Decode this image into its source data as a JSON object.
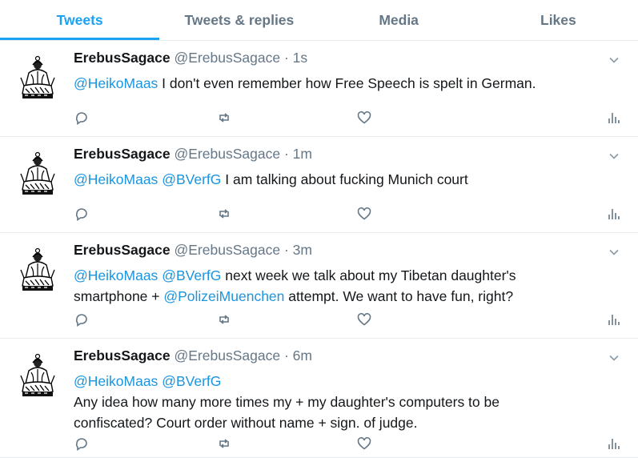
{
  "tabs": [
    "Tweets",
    "Tweets & replies",
    "Media",
    "Likes"
  ],
  "tweets": [
    {
      "name": "ErebusSagace",
      "handle": "@ErebusSagace",
      "dot": "·",
      "time": "1s",
      "lines": [
        [
          {
            "m": "@HeikoMaas"
          },
          {
            "t": " I don't even remember how Free Speech is spelt in German."
          }
        ]
      ]
    },
    {
      "name": "ErebusSagace",
      "handle": "@ErebusSagace",
      "dot": "·",
      "time": "1m",
      "lines": [
        [
          {
            "m": "@HeikoMaas"
          },
          {
            "t": " "
          },
          {
            "m": "@BVerfG"
          },
          {
            "t": " I am talking about fucking Munich court"
          }
        ]
      ]
    },
    {
      "name": "ErebusSagace",
      "handle": "@ErebusSagace",
      "dot": "·",
      "time": "3m",
      "lines": [
        [
          {
            "m": "@HeikoMaas"
          },
          {
            "t": " "
          },
          {
            "m": "@BVerfG"
          },
          {
            "t": " next week we talk about my Tibetan daughter's"
          }
        ],
        [
          {
            "t": "smartphone + "
          },
          {
            "m": "@PolizeiMuenchen"
          },
          {
            "t": " attempt. We want to have fun, right?"
          }
        ]
      ]
    },
    {
      "name": "ErebusSagace",
      "handle": "@ErebusSagace",
      "dot": "·",
      "time": "6m",
      "lines": [
        [
          {
            "m": "@HeikoMaas"
          },
          {
            "t": " "
          },
          {
            "m": "@BVerfG"
          }
        ],
        [
          {
            "t": "Any idea how many more times my + my daughter's computers to be"
          }
        ],
        [
          {
            "t": "confiscated? Court order without name + sign. of judge."
          }
        ]
      ]
    }
  ],
  "colors": {
    "accent": "#1da1f2",
    "mention": "#1b95e0",
    "muted": "#657786",
    "divider": "#e6ecf0"
  },
  "icons": {
    "reply": "reply-icon",
    "retweet": "retweet-icon",
    "like": "like-icon",
    "analytics": "analytics-icon",
    "caret": "chevron-down-icon"
  }
}
